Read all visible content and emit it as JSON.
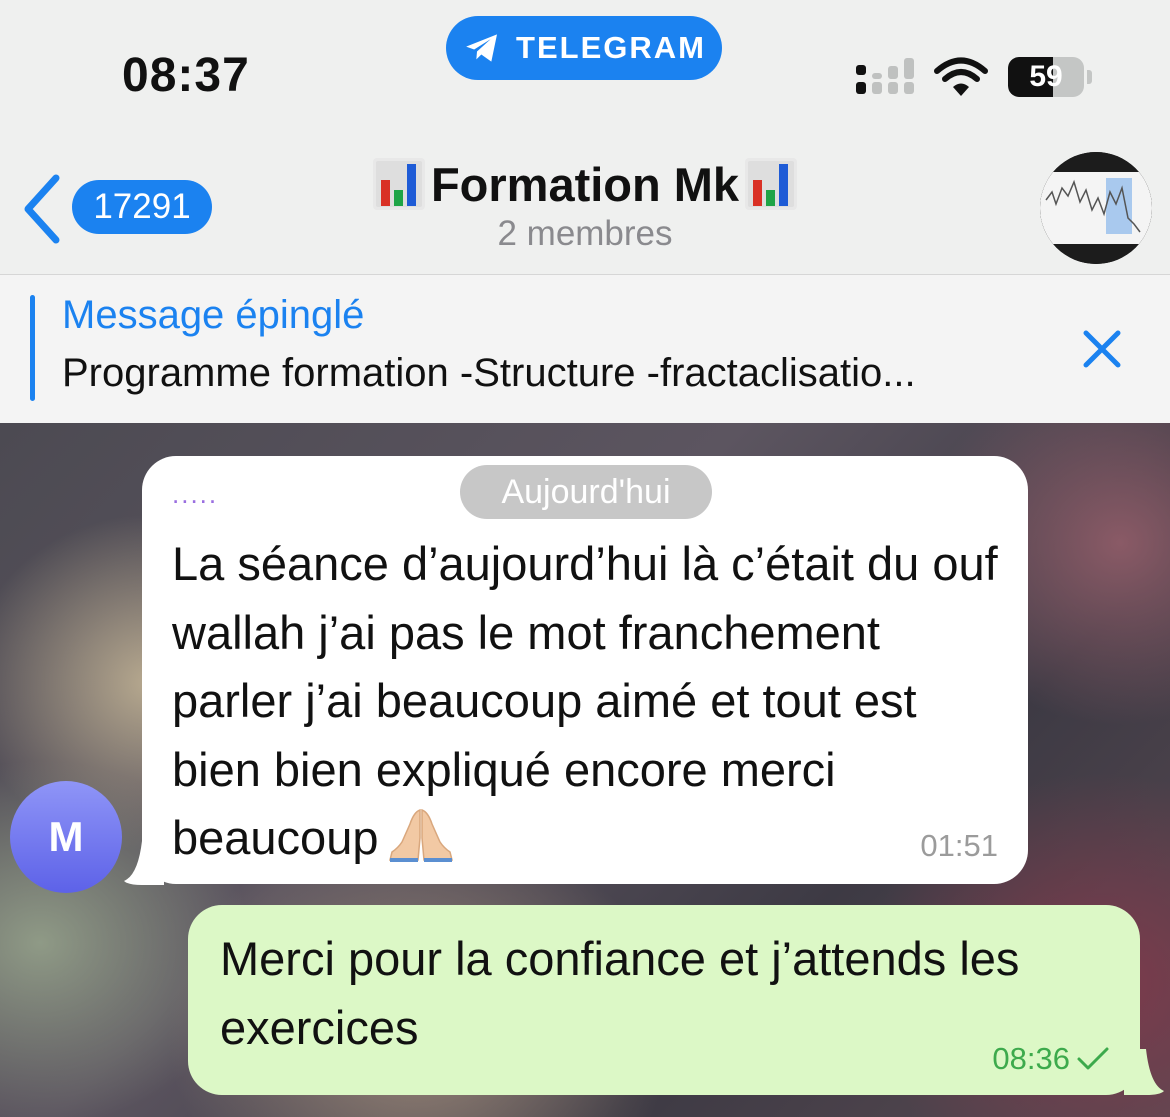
{
  "status_bar": {
    "time": "08:37",
    "app_pill_label": "TELEGRAM",
    "battery_level": "59",
    "battery_percent": 59
  },
  "header": {
    "back_count": "17291",
    "title": "Formation Mk",
    "subtitle": "2 membres"
  },
  "pinned": {
    "label": "Message épinglé",
    "text": "Programme formation -Structure -fractaclisatio..."
  },
  "chat": {
    "date_chip": "Aujourd'hui",
    "sender_initial": "M",
    "incoming": {
      "sender_name_placeholder": ".....",
      "text": "La séance d’aujourd’hui là c’était du ouf wallah j’ai pas le mot franchement parler j’ai beaucoup aimé et tout est bien bien expliqué encore merci beaucoup",
      "emoji": "folded-hands",
      "time": "01:51"
    },
    "outgoing": {
      "text": "Merci pour la confiance et j’attends les exercices",
      "time": "08:36",
      "status_icon": "single-check-icon"
    }
  },
  "colors": {
    "accent": "#1b82f0",
    "outgoing_bubble": "#dcf8c6",
    "outgoing_time": "#3daa4c",
    "avatar_gradient": [
      "#8f95f7",
      "#5d62e8"
    ]
  }
}
